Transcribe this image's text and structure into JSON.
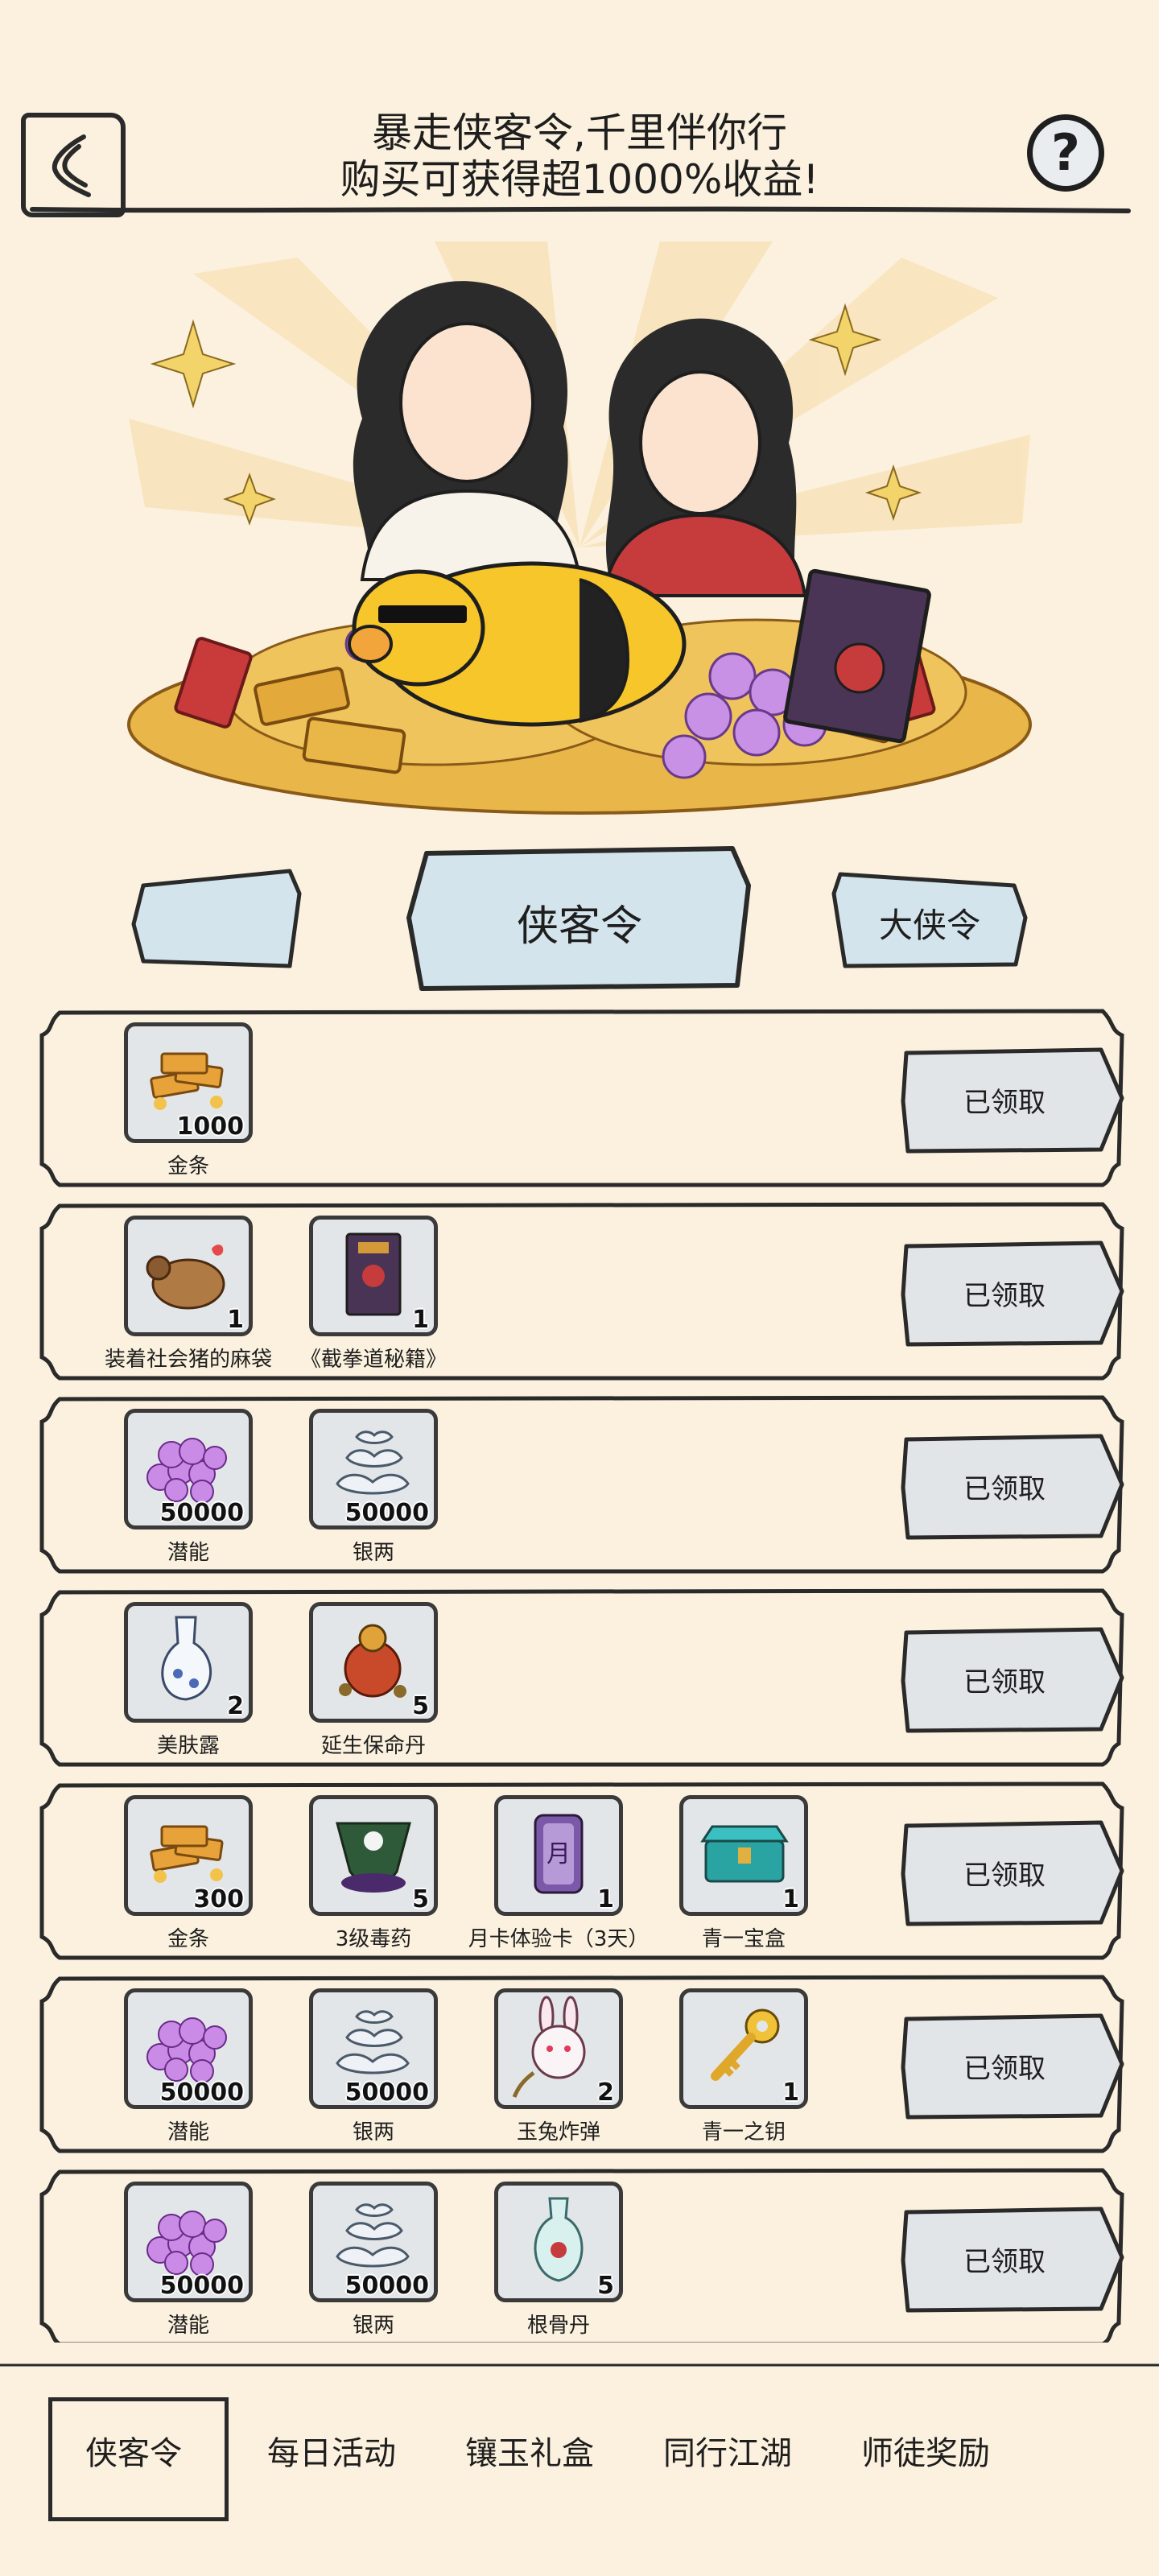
{
  "header": {
    "back_icon": "back-arrow-icon",
    "title_line1": "暴走侠客令,千里伴你行",
    "title_line2": "购买可获得超1000%收益!",
    "help_label": "?"
  },
  "tabs": [
    {
      "label": ""
    },
    {
      "label": "侠客令"
    },
    {
      "label": "大侠令"
    }
  ],
  "claim_label": "已领取",
  "rows": [
    {
      "items": [
        {
          "name": "金条",
          "qty": "1000",
          "icon": "gold-bars-icon"
        }
      ]
    },
    {
      "items": [
        {
          "name": "装着社会猪的麻袋",
          "qty": "1",
          "icon": "sack-pig-icon"
        },
        {
          "name": "《截拳道秘籍》",
          "qty": "1",
          "icon": "book-icon"
        }
      ]
    },
    {
      "items": [
        {
          "name": "潜能",
          "qty": "50000",
          "icon": "potential-orbs-icon"
        },
        {
          "name": "银两",
          "qty": "50000",
          "icon": "silver-ingots-icon"
        }
      ]
    },
    {
      "items": [
        {
          "name": "美肤露",
          "qty": "2",
          "icon": "lotion-bottle-icon"
        },
        {
          "name": "延生保命丹",
          "qty": "5",
          "icon": "elixir-gourd-icon"
        }
      ]
    },
    {
      "items": [
        {
          "name": "金条",
          "qty": "300",
          "icon": "gold-bars-icon"
        },
        {
          "name": "3级毒药",
          "qty": "5",
          "icon": "poison-icon"
        },
        {
          "name": "月卡体验卡（3天）",
          "qty": "1",
          "icon": "month-card-icon"
        },
        {
          "name": "青一宝盒",
          "qty": "1",
          "icon": "treasure-chest-icon"
        }
      ]
    },
    {
      "items": [
        {
          "name": "潜能",
          "qty": "50000",
          "icon": "potential-orbs-icon"
        },
        {
          "name": "银两",
          "qty": "50000",
          "icon": "silver-ingots-icon"
        },
        {
          "name": "玉兔炸弹",
          "qty": "2",
          "icon": "rabbit-bomb-icon"
        },
        {
          "name": "青一之钥",
          "qty": "1",
          "icon": "golden-key-icon"
        }
      ]
    },
    {
      "items": [
        {
          "name": "潜能",
          "qty": "50000",
          "icon": "potential-orbs-icon"
        },
        {
          "name": "银两",
          "qty": "50000",
          "icon": "silver-ingots-icon"
        },
        {
          "name": "根骨丹",
          "qty": "5",
          "icon": "vase-icon"
        }
      ]
    }
  ],
  "bottom_nav": [
    {
      "label": "侠客令",
      "active": true
    },
    {
      "label": "每日活动"
    },
    {
      "label": "镶玉礼盒"
    },
    {
      "label": "同行江湖"
    },
    {
      "label": "师徒奖励"
    }
  ],
  "colors": {
    "background": "#fbf1de",
    "tab_fill": "#d4e4ec",
    "claim_fill": "#e1e5e8",
    "ink": "#2a2a2a"
  }
}
